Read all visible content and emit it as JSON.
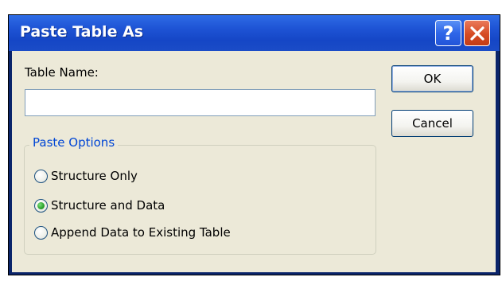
{
  "dialog": {
    "title": "Paste Table As",
    "help_glyph": "?",
    "close_glyph": "✕"
  },
  "form": {
    "table_name_label": "Table Name:",
    "table_name_value": "",
    "paste_options_label": "Paste Options",
    "options": [
      {
        "label": "Structure Only",
        "selected": false
      },
      {
        "label": "Structure and Data",
        "selected": true
      },
      {
        "label": "Append Data to Existing Table",
        "selected": false
      }
    ]
  },
  "buttons": {
    "ok": "OK",
    "cancel": "Cancel"
  },
  "colors": {
    "title_bar": "#1f55d6",
    "dialog_bg": "#ece9d8",
    "group_label": "#0046d5",
    "close_button": "#d64b23"
  }
}
